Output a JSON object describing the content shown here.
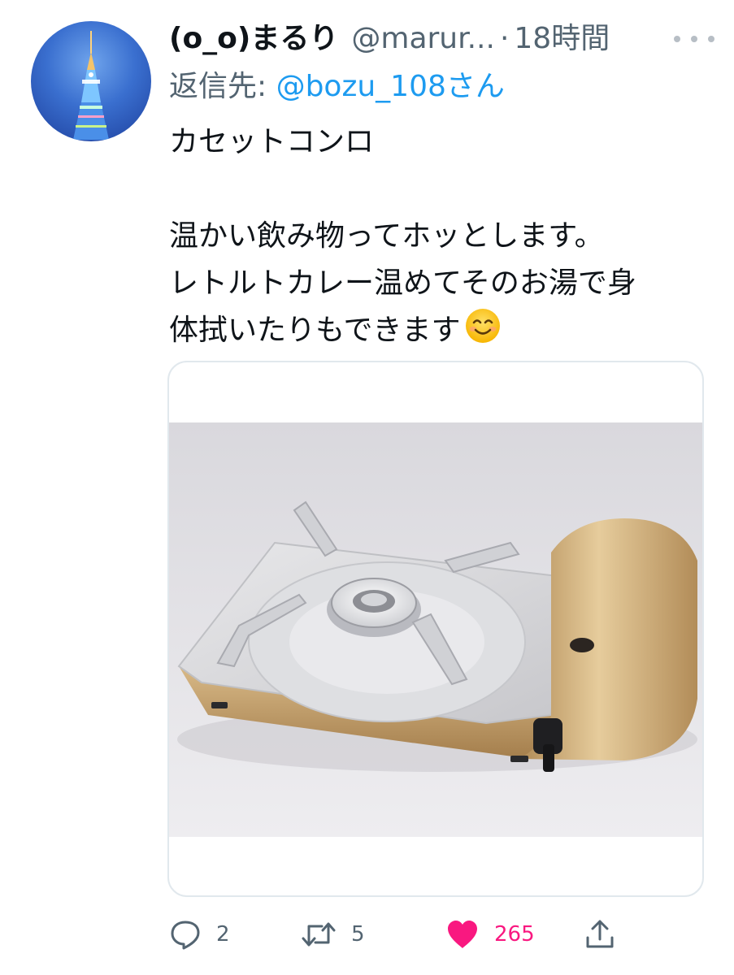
{
  "tweet": {
    "display_name": "(o_o)まるり",
    "handle": "@marur...",
    "separator": "·",
    "time": "18時間",
    "reply_prefix": "返信先: ",
    "reply_target": "@bozu_108さん",
    "body_lines": [
      "カセットコンロ",
      "",
      "温かい飲み物ってホッとします。",
      "レトルトカレー温めてそのお湯で身",
      "体拭いたりもできます"
    ],
    "emoji": "smiling-face-emoji"
  },
  "actions": {
    "reply_count": "2",
    "retweet_count": "5",
    "like_count": "265",
    "liked": true
  },
  "icons": {
    "reply": "speech-bubble-icon",
    "retweet": "retweet-arrows-icon",
    "like": "heart-icon",
    "share": "share-upload-icon",
    "more": "more-dots-icon"
  },
  "colors": {
    "text": "#0f1419",
    "secondary": "#536471",
    "link": "#1d9bf0",
    "like": "#f91880",
    "border": "#e1e8ed"
  }
}
